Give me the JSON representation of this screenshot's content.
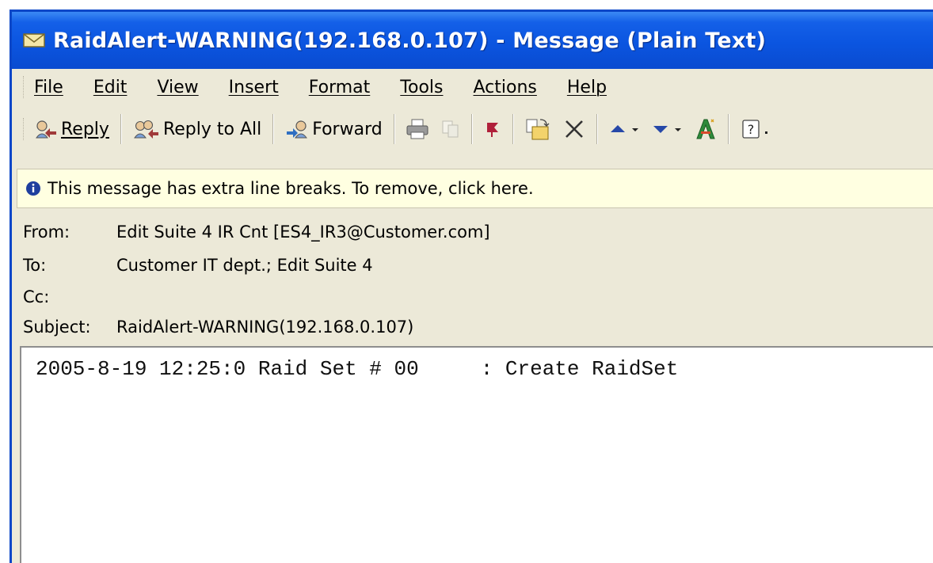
{
  "window": {
    "title": "RaidAlert-WARNING(192.168.0.107) - Message (Plain Text)",
    "accent_color": "#0b55e0",
    "title_icon": "envelope-icon"
  },
  "menu": [
    "File",
    "Edit",
    "View",
    "Insert",
    "Format",
    "Tools",
    "Actions",
    "Help"
  ],
  "toolbar": {
    "reply_label": "Reply",
    "reply_all_label": "Reply to All",
    "forward_label": "Forward",
    "icons": [
      "print-icon",
      "copy-icon",
      "flag-icon",
      "move-to-folder-icon",
      "delete-icon",
      "previous-item-icon",
      "next-item-icon",
      "address-book-icon",
      "help-icon"
    ]
  },
  "infobar": {
    "text": "This message has extra line breaks. To remove, click here.",
    "background": "#ffffe1"
  },
  "header": {
    "from_label": "From:",
    "from_value": "Edit Suite 4 IR Cnt [ES4_IR3@Customer.com]",
    "to_label": "To:",
    "to_value": "Customer IT dept.; Edit Suite 4",
    "cc_label": "Cc:",
    "cc_value": "",
    "subject_label": "Subject:",
    "subject_value": "RaidAlert-WARNING(192.168.0.107)"
  },
  "message": {
    "body": "2005-8-19 12:25:0 Raid Set # 00     : Create RaidSet"
  }
}
